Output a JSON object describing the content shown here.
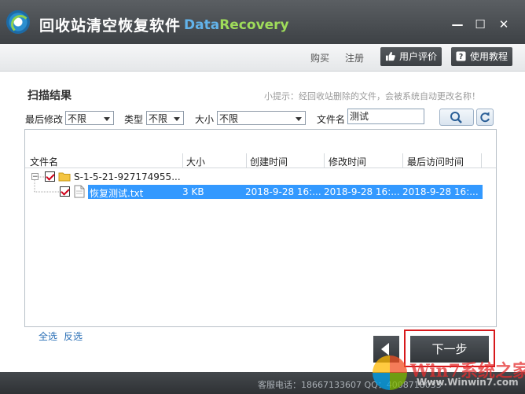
{
  "window": {
    "title": "回收站清空恢复软件",
    "subtitle_part1": "Data",
    "subtitle_part2": "Recovery",
    "minimize": "—",
    "maximize": "☐",
    "close": "✕"
  },
  "toolbar": {
    "buy": "购买",
    "register": "注册",
    "review_button": "用户评价",
    "tutorial_button": "使用教程"
  },
  "content": {
    "section_title": "扫描结果",
    "tip": "小提示：经回收站删除的文件，会被系统自动更改名称！"
  },
  "filters": {
    "last_modified_label": "最后修改",
    "last_modified_value": "不限",
    "type_label": "类型",
    "type_value": "不限",
    "size_label": "大小",
    "size_value": "不限",
    "filename_label": "文件名",
    "filename_value": "测试"
  },
  "table": {
    "columns": [
      "文件名",
      "大小",
      "创建时间",
      "修改时间",
      "最后访问时间"
    ],
    "folder": {
      "name": "S-1-5-21-927174955..."
    },
    "rows": [
      {
        "name": "恢复测试.txt",
        "size": "3 KB",
        "created": "2018-9-28 16:...",
        "modified": "2018-9-28 16:...",
        "accessed": "2018-9-28 16:..."
      }
    ]
  },
  "selection": {
    "select_all": "全选",
    "invert": "反选"
  },
  "buttons": {
    "next": "下一步"
  },
  "status": {
    "text": "客服电话：18667133607  QQ：4008718033"
  },
  "watermark": {
    "text": "Win7系统之家",
    "sub": "Www.Winwin7.com"
  },
  "colors": {
    "titlebar": "#4a4e52",
    "accent_green": "#9fdc5a",
    "accent_blue": "#62b3ea",
    "selection": "#3399ff",
    "highlight_border": "#d7191c"
  }
}
